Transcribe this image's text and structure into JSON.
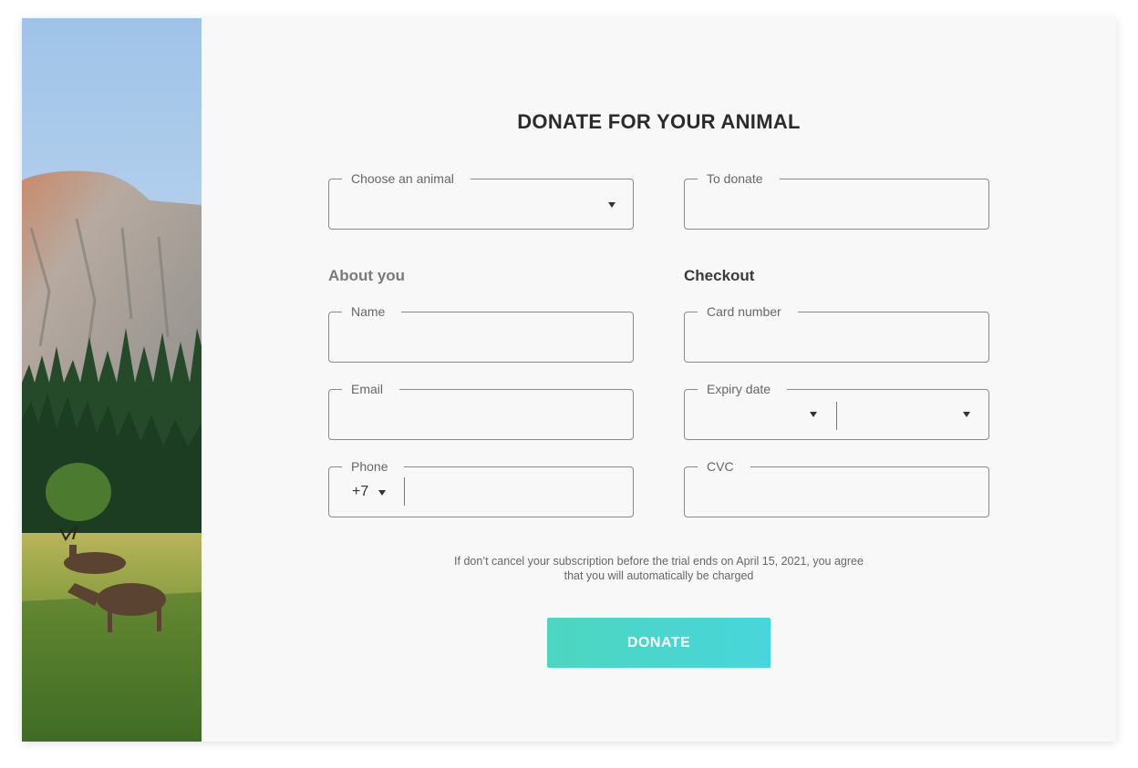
{
  "form": {
    "title": "DONATE FOR YOUR ANIMAL",
    "animal": {
      "label": "Choose an animal",
      "value": ""
    },
    "amount": {
      "label": "To donate",
      "value": ""
    },
    "about": {
      "heading": "About you",
      "name_label": "Name",
      "email_label": "Email",
      "phone_label": "Phone",
      "phone_code": "+7"
    },
    "checkout": {
      "heading": "Checkout",
      "card_label": "Card number",
      "expiry_label": "Expiry date",
      "cvc_label": "CVC"
    },
    "notice_line1": "If don’t cancel your subscription before the trial ends on April 15, 2021, you agree",
    "notice_line2": "that you will automatically be charged",
    "donate_label": "DONATE"
  },
  "icons": {
    "dropdown": "caret-down-icon"
  },
  "colors": {
    "accent_start": "#4dd6bf",
    "accent_end": "#47d6db",
    "field_border": "#8a8a8a",
    "background": "#f8f8f8"
  }
}
